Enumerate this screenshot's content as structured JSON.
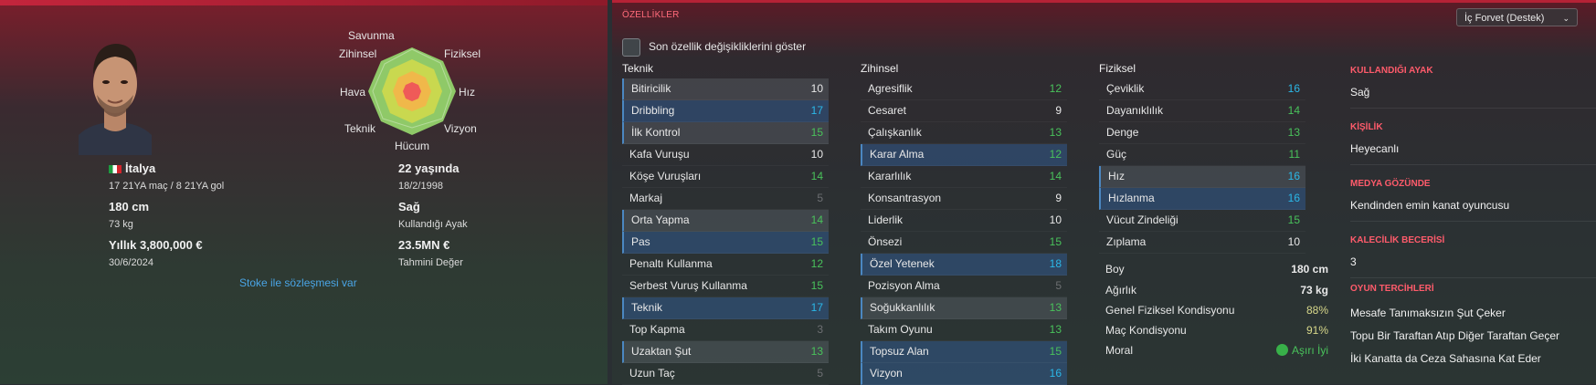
{
  "player": {
    "nationality": "İtalya",
    "caps": "17 21YA maç / 8 21YA gol",
    "height": "180 cm",
    "weight": "73 kg",
    "wage": "Yıllık 3,800,000 €",
    "contract_end": "30/6/2024",
    "age": "22 yaşında",
    "birthdate": "18/2/1998",
    "foot": "Sağ",
    "foot_label": "Kullandığı Ayak",
    "value": "23.5MN €",
    "value_label": "Tahmini Değer",
    "contract_text": "Stoke ile sözleşmesi var"
  },
  "radar": {
    "labels": [
      "Savunma",
      "Fiziksel",
      "Hız",
      "Vizyon",
      "Hücum",
      "Teknik",
      "Hava",
      "Zihinsel"
    ]
  },
  "panel": {
    "title": "ÖZELLİKLER",
    "role_dropdown": "İç Forvet (Destek)",
    "checkbox_label": "Son özellik değişikliklerini göster"
  },
  "attributes": {
    "teknik": {
      "header": "Teknik",
      "items": [
        {
          "name": "Bitiricilik",
          "value": "10",
          "color": "w",
          "style": "hi"
        },
        {
          "name": "Dribbling",
          "value": "17",
          "color": "c",
          "style": "hb"
        },
        {
          "name": "İlk Kontrol",
          "value": "15",
          "color": "g",
          "style": "hi"
        },
        {
          "name": "Kafa Vuruşu",
          "value": "10",
          "color": "w",
          "style": ""
        },
        {
          "name": "Köşe Vuruşları",
          "value": "14",
          "color": "g",
          "style": ""
        },
        {
          "name": "Markaj",
          "value": "5",
          "color": "d",
          "style": ""
        },
        {
          "name": "Orta Yapma",
          "value": "14",
          "color": "g",
          "style": "hi"
        },
        {
          "name": "Pas",
          "value": "15",
          "color": "g",
          "style": "hb"
        },
        {
          "name": "Penaltı Kullanma",
          "value": "12",
          "color": "g",
          "style": ""
        },
        {
          "name": "Serbest Vuruş Kullanma",
          "value": "15",
          "color": "g",
          "style": ""
        },
        {
          "name": "Teknik",
          "value": "17",
          "color": "c",
          "style": "hb"
        },
        {
          "name": "Top Kapma",
          "value": "3",
          "color": "d",
          "style": ""
        },
        {
          "name": "Uzaktan Şut",
          "value": "13",
          "color": "g",
          "style": "hi"
        },
        {
          "name": "Uzun Taç",
          "value": "5",
          "color": "d",
          "style": ""
        }
      ]
    },
    "zihinsel": {
      "header": "Zihinsel",
      "items": [
        {
          "name": "Agresiflik",
          "value": "12",
          "color": "g",
          "style": ""
        },
        {
          "name": "Cesaret",
          "value": "9",
          "color": "w",
          "style": ""
        },
        {
          "name": "Çalışkanlık",
          "value": "13",
          "color": "g",
          "style": ""
        },
        {
          "name": "Karar Alma",
          "value": "12",
          "color": "g",
          "style": "hb"
        },
        {
          "name": "Kararlılık",
          "value": "14",
          "color": "g",
          "style": ""
        },
        {
          "name": "Konsantrasyon",
          "value": "9",
          "color": "w",
          "style": ""
        },
        {
          "name": "Liderlik",
          "value": "10",
          "color": "w",
          "style": ""
        },
        {
          "name": "Önsezi",
          "value": "15",
          "color": "g",
          "style": ""
        },
        {
          "name": "Özel Yetenek",
          "value": "18",
          "color": "c",
          "style": "hb"
        },
        {
          "name": "Pozisyon Alma",
          "value": "5",
          "color": "d",
          "style": ""
        },
        {
          "name": "Soğukkanlılık",
          "value": "13",
          "color": "g",
          "style": "hi"
        },
        {
          "name": "Takım Oyunu",
          "value": "13",
          "color": "g",
          "style": ""
        },
        {
          "name": "Topsuz Alan",
          "value": "15",
          "color": "g",
          "style": "hb"
        },
        {
          "name": "Vizyon",
          "value": "16",
          "color": "c",
          "style": "hb"
        }
      ]
    },
    "fiziksel": {
      "header": "Fiziksel",
      "items": [
        {
          "name": "Çeviklik",
          "value": "16",
          "color": "c",
          "style": ""
        },
        {
          "name": "Dayanıklılık",
          "value": "14",
          "color": "g",
          "style": ""
        },
        {
          "name": "Denge",
          "value": "13",
          "color": "g",
          "style": ""
        },
        {
          "name": "Güç",
          "value": "11",
          "color": "g",
          "style": ""
        },
        {
          "name": "Hız",
          "value": "16",
          "color": "c",
          "style": "hi"
        },
        {
          "name": "Hızlanma",
          "value": "16",
          "color": "c",
          "style": "hb"
        },
        {
          "name": "Vücut Zindeliği",
          "value": "15",
          "color": "g",
          "style": ""
        },
        {
          "name": "Zıplama",
          "value": "10",
          "color": "w",
          "style": ""
        }
      ]
    }
  },
  "physical_stats": [
    {
      "label": "Boy",
      "value": "180 cm"
    },
    {
      "label": "Ağırlık",
      "value": "73 kg"
    },
    {
      "label": "Genel Fiziksel Kondisyonu",
      "value": "88%"
    },
    {
      "label": "Maç Kondisyonu",
      "value": "91%"
    },
    {
      "label": "Moral",
      "value": "Aşırı İyi"
    }
  ],
  "side": {
    "foot_header": "KULLANDIĞI AYAK",
    "foot_value": "Sağ",
    "personality_header": "KİŞİLİK",
    "personality_value": "Heyecanlı",
    "media_header": "MEDYA GÖZÜNDE",
    "media_value": "Kendinden emin kanat oyuncusu",
    "gk_header": "KALECİLİK BECERİSİ",
    "gk_value": "3",
    "prefs_header": "OYUN TERCİHLERİ",
    "prefs": [
      "Mesafe Tanımaksızın Şut Çeker",
      "Topu Bir Taraftan Atıp Diğer Taraftan Geçer",
      "İki Kanatta da Ceza Sahasına Kat Eder"
    ]
  }
}
